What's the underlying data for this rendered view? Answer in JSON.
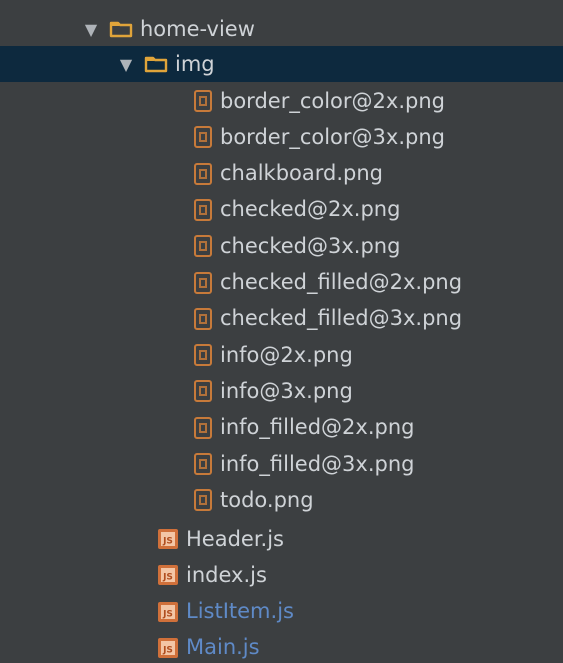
{
  "tree": {
    "folders": [
      {
        "name": "home-view",
        "expanded": true,
        "icon": "folder-icon"
      },
      {
        "name": "img",
        "expanded": true,
        "selected": true,
        "icon": "folder-icon"
      }
    ],
    "img_files": [
      "border_color@2x.png",
      "border_color@3x.png",
      "chalkboard.png",
      "checked@2x.png",
      "checked@3x.png",
      "checked_filled@2x.png",
      "checked_filled@3x.png",
      "info@2x.png",
      "info@3x.png",
      "info_filled@2x.png",
      "info_filled@3x.png",
      "todo.png"
    ],
    "js_files": [
      {
        "name": "Header.js",
        "modified": false
      },
      {
        "name": "index.js",
        "modified": false
      },
      {
        "name": "ListItem.js",
        "modified": true
      },
      {
        "name": "Main.js",
        "modified": true
      }
    ],
    "icons": {
      "expand": "triangle-down-icon",
      "image_file": "image-file-icon",
      "js_file": "js-file-icon"
    },
    "colors": {
      "background": "#3c3f41",
      "selected_row": "#0d293e",
      "text": "#cfd3d7",
      "modified_text": "#5f8ac7",
      "folder": "#e0a43a",
      "image_icon": "#c77a3a",
      "js_icon": "#d0703a"
    }
  }
}
